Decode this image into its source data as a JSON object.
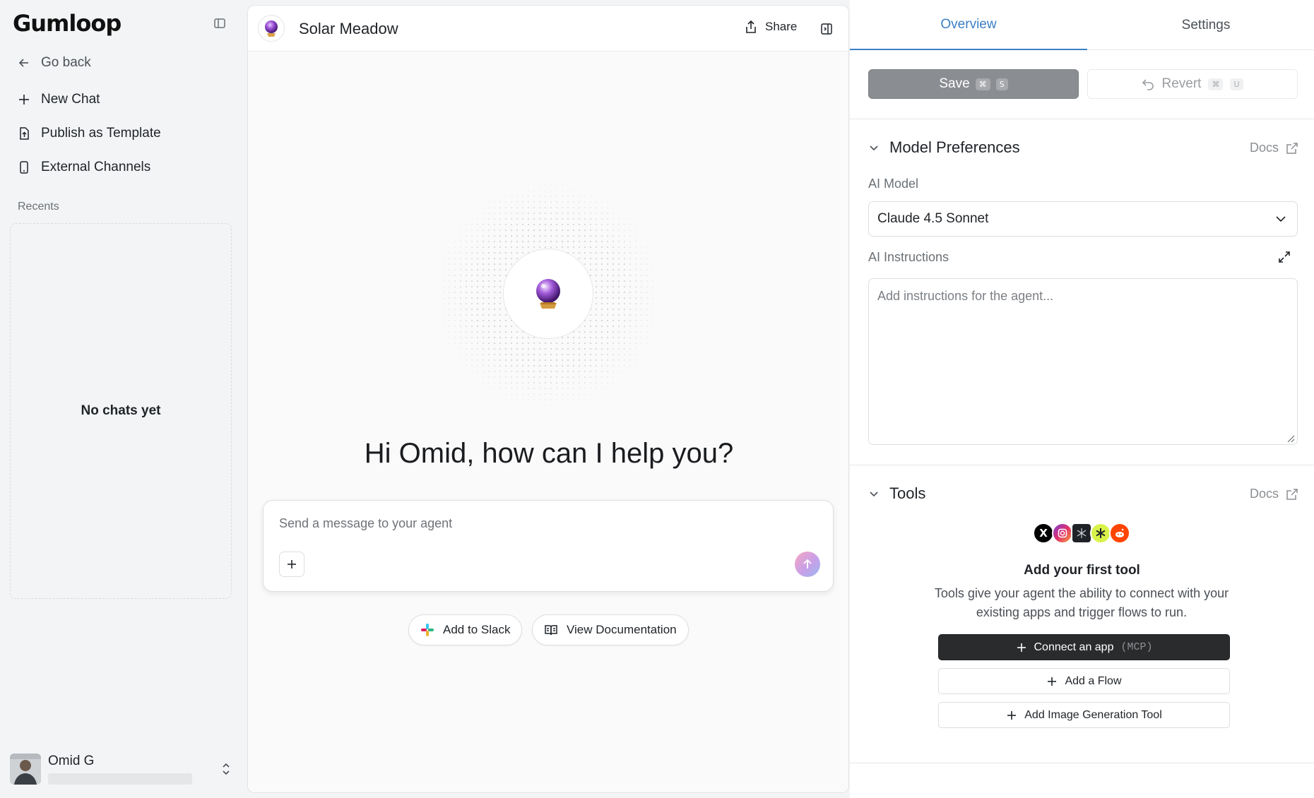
{
  "sidebar": {
    "logo": "Gumloop",
    "go_back": "Go back",
    "items": [
      {
        "label": "New Chat",
        "icon": "plus-icon"
      },
      {
        "label": "Publish as Template",
        "icon": "file-upload-icon"
      },
      {
        "label": "External Channels",
        "icon": "phone-icon"
      }
    ],
    "recents_label": "Recents",
    "empty_recents": "No chats yet",
    "user": {
      "name": "Omid G"
    }
  },
  "main": {
    "agent_name": "Solar Meadow",
    "share_label": "Share",
    "greeting": "Hi Omid, how can I help you?",
    "composer_placeholder": "Send a message to your agent",
    "quick_actions": [
      {
        "label": "Add to Slack",
        "icon": "slack-icon"
      },
      {
        "label": "View Documentation",
        "icon": "book-icon"
      }
    ],
    "agent_icon": "crystal-ball-icon"
  },
  "right_panel": {
    "tabs": [
      {
        "label": "Overview",
        "active": true
      },
      {
        "label": "Settings",
        "active": false
      }
    ],
    "save": {
      "label": "Save",
      "shortcut_mod": "⌘",
      "shortcut_key": "S"
    },
    "revert": {
      "label": "Revert",
      "shortcut_mod": "⌘",
      "shortcut_key": "U"
    },
    "model_section": {
      "title": "Model Preferences",
      "docs_label": "Docs",
      "ai_model_label": "AI Model",
      "ai_model_value": "Claude 4.5 Sonnet",
      "instructions_label": "AI Instructions",
      "instructions_placeholder": "Add instructions for the agent..."
    },
    "tools_section": {
      "title": "Tools",
      "docs_label": "Docs",
      "empty_title": "Add your first tool",
      "empty_desc": "Tools give your agent the ability to connect with your existing apps and trigger flows to run.",
      "connect_label": "Connect an app",
      "connect_tag": "(MCP)",
      "add_flow_label": "Add a Flow",
      "add_image_tool_label": "Add Image Generation Tool",
      "tool_icons": [
        "x-icon",
        "instagram-icon",
        "perplexity-icon",
        "asterisk-icon",
        "reddit-icon"
      ]
    }
  },
  "colors": {
    "accent": "#3b7fc4",
    "sidebar_bg": "#f3f4f6",
    "dark_button": "#2a2b2d",
    "save_button": "#8a8d91"
  }
}
